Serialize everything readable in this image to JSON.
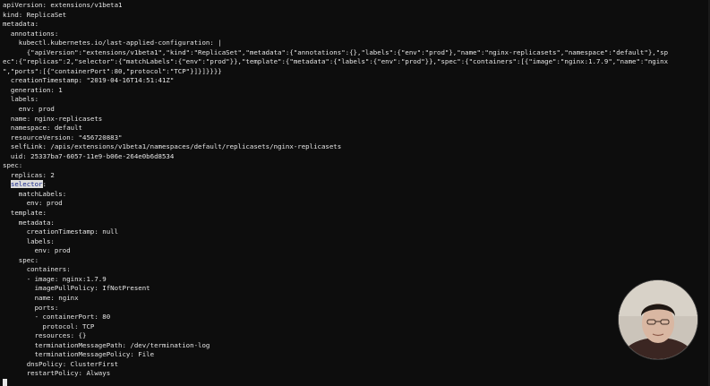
{
  "terminal": {
    "lines": [
      "apiVersion: extensions/v1beta1",
      "kind: ReplicaSet",
      "metadata:",
      "  annotations:",
      "    kubectl.kubernetes.io/last-applied-configuration: |",
      "      {\"apiVersion\":\"extensions/v1beta1\",\"kind\":\"ReplicaSet\",\"metadata\":{\"annotations\":{},\"labels\":{\"env\":\"prod\"},\"name\":\"nginx-replicasets\",\"namespace\":\"default\"},\"sp",
      "ec\":{\"replicas\":2,\"selector\":{\"matchLabels\":{\"env\":\"prod\"}},\"template\":{\"metadata\":{\"labels\":{\"env\":\"prod\"}},\"spec\":{\"containers\":[{\"image\":\"nginx:1.7.9\",\"name\":\"nginx",
      "\",\"ports\":[{\"containerPort\":80,\"protocol\":\"TCP\"}]}]}}}}",
      "  creationTimestamp: \"2019-04-16T14:51:41Z\"",
      "  generation: 1",
      "  labels:",
      "    env: prod",
      "  name: nginx-replicasets",
      "  namespace: default",
      "  resourceVersion: \"456720883\"",
      "  selfLink: /apis/extensions/v1beta1/namespaces/default/replicasets/nginx-replicasets",
      "  uid: 25337ba7-6057-11e9-b06e-264e0b6d8534",
      "spec:",
      "  replicas: 2",
      "  selector:",
      "    matchLabels:",
      "      env: prod",
      "  template:",
      "    metadata:",
      "      creationTimestamp: null",
      "      labels:",
      "        env: prod",
      "    spec:",
      "      containers:",
      "      - image: nginx:1.7.9",
      "        imagePullPolicy: IfNotPresent",
      "        name: nginx",
      "        ports:",
      "        - containerPort: 80",
      "          protocol: TCP",
      "        resources: {}",
      "        terminationMessagePath: /dev/termination-log",
      "        terminationMessagePolicy: File",
      "      dnsPolicy: ClusterFirst",
      "      restartPolicy: Always"
    ],
    "selection": {
      "line_index": 19,
      "text": "selector",
      "before": "  ",
      "after": ":"
    }
  }
}
